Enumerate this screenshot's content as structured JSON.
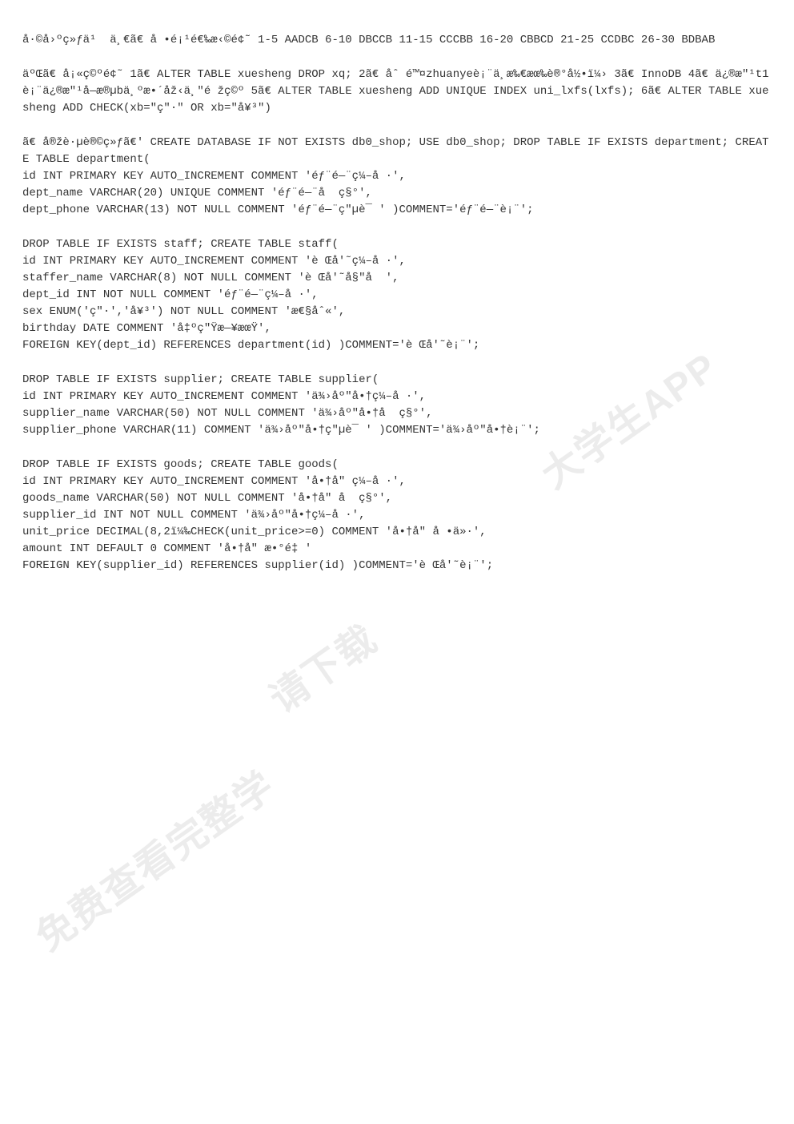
{
  "paragraphs": [
    "å·©å›ºç»ƒä¹  ä¸€ã€ å •é¡¹é€‰æ‹©é¢˜ 1-5 AADCB 6-10 DBCCB 11-15 CCCBB 16-20 CBBCD 21-25 CCDBC 26-30 BDBAB",
    "äºŒã€ å¡«ç©ºé¢˜ 1ã€ ALTER TABLE xuesheng DROP xq; 2ã€ åˆ é™¤zhuanyeè¡¨ä¸æ‰€æœ‰è®°å½•ï¼› 3ã€ InnoDB 4ã€ ä¿®æ″¹t1è¡¨ä¿®æ″¹å—æ®µbä¸ºæ•´åž‹ä¸″é žç©º 5ã€ ALTER TABLE xuesheng ADD UNIQUE INDEX uni_lxfs(lxfs); 6ã€ ALTER TABLE xuesheng ADD CHECK(xb=\"ç″·\" OR xb=\"å¥³\")",
    "ã€ å®žè·µè®©ç»ƒã€' CREATE DATABASE IF NOT EXISTS db0_shop; USE db0_shop; DROP TABLE IF EXISTS department; CREATE TABLE department(\nid INT PRIMARY KEY AUTO_INCREMENT COMMENT 'éƒ¨é—¨ç¼–å ·',\ndept_name VARCHAR(20) UNIQUE COMMENT 'éƒ¨é—¨å  ç§°',\ndept_phone VARCHAR(13) NOT NULL COMMENT 'éƒ¨é—¨ç″µè¯ ' )COMMENT='éƒ¨é—¨è¡¨';",
    "DROP TABLE IF EXISTS staff; CREATE TABLE staff(\nid INT PRIMARY KEY AUTO_INCREMENT COMMENT 'è Œå'˜ç¼–å ·',\nstaffer_name VARCHAR(8) NOT NULL COMMENT 'è Œå'˜å§″å  ',\ndept_id INT NOT NULL COMMENT 'éƒ¨é—¨ç¼–å ·',\nsex ENUM('ç″·','å¥³') NOT NULL COMMENT 'æ€§åˆ«',\nbirthday DATE COMMENT 'å‡ºç″Ÿæ—¥æœŸ',\nFOREIGN KEY(dept_id) REFERENCES department(id) )COMMENT='è Œå'˜è¡¨';",
    "DROP TABLE IF EXISTS supplier; CREATE TABLE supplier(\nid INT PRIMARY KEY AUTO_INCREMENT COMMENT 'ä¾›åº″å•†ç¼–å ·',\nsupplier_name VARCHAR(50) NOT NULL COMMENT 'ä¾›åº″å•†å  ç§°',\nsupplier_phone VARCHAR(11) COMMENT 'ä¾›åº″å•†ç″µè¯ ' )COMMENT='ä¾›åº″å•†è¡¨';",
    "DROP TABLE IF EXISTS goods; CREATE TABLE goods(\nid INT PRIMARY KEY AUTO_INCREMENT COMMENT 'å•†å″ ç¼–å ·',\ngoods_name VARCHAR(50) NOT NULL COMMENT 'å•†å″ å  ç§°',\nsupplier_id INT NOT NULL COMMENT 'ä¾›åº″å•†ç¼–å ·',\nunit_price DECIMAL(8,2ï¼‰CHECK(unit_price>=0) COMMENT 'å•†å″ å •ä»·',\namount INT DEFAULT 0 COMMENT 'å•†å″ æ•°é‡ '\nFOREIGN KEY(supplier_id) REFERENCES supplier(id) )COMMENT='è Œå'˜è¡¨';"
  ],
  "watermarks": {
    "w1": "大学生APP",
    "w2": "请下载",
    "w3": "免费查看完整学"
  }
}
